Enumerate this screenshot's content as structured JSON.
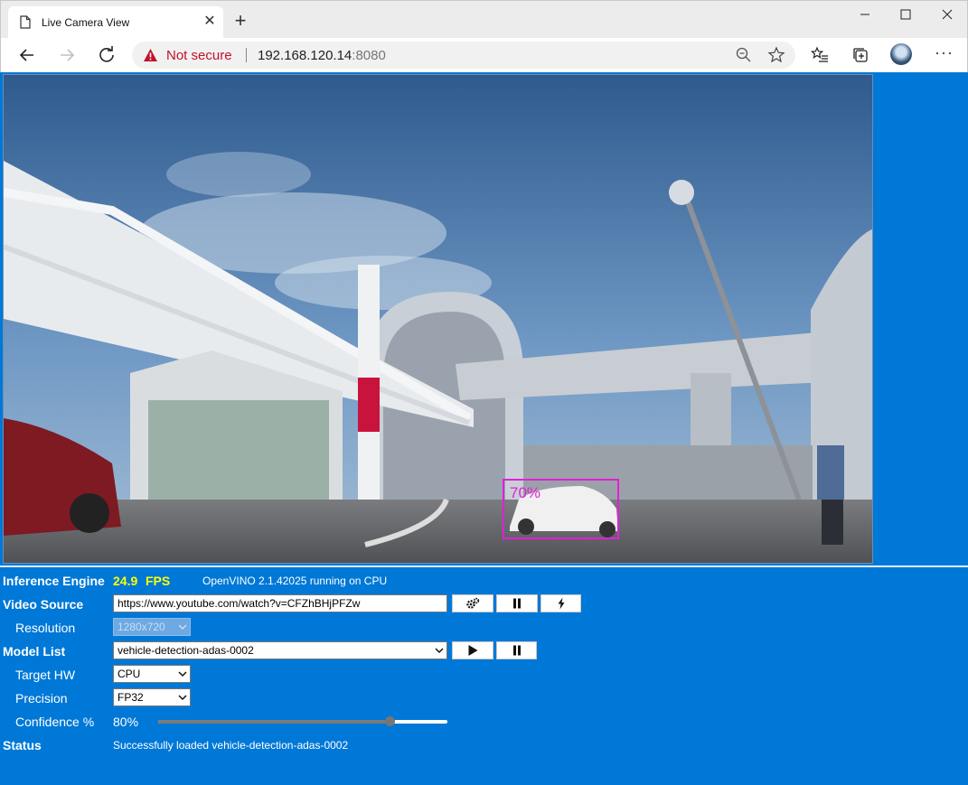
{
  "browser": {
    "tab_title": "Live Camera View",
    "security_label": "Not secure",
    "url_host": "192.168.120.14",
    "url_port": ":8080"
  },
  "detection": {
    "label": "70%",
    "color": "#e020d8"
  },
  "inference": {
    "label": "Inference Engine",
    "fps_value": "24.9",
    "fps_unit": "FPS",
    "engine_info": "OpenVINO 2.1.42025 running on CPU"
  },
  "video_source": {
    "label": "Video Source",
    "url_value": "https://www.youtube.com/watch?v=CFZhBHjPFZw",
    "buttons": [
      "settings-icon",
      "pause-icon",
      "flash-icon"
    ]
  },
  "resolution": {
    "label": "Resolution",
    "selected": "1280x720"
  },
  "model_list": {
    "label": "Model List",
    "selected": "vehicle-detection-adas-0002",
    "buttons": [
      "play-icon",
      "pause-icon"
    ]
  },
  "target_hw": {
    "label": "Target HW",
    "selected": "CPU"
  },
  "precision": {
    "label": "Precision",
    "selected": "FP32"
  },
  "confidence": {
    "label": "Confidence %",
    "value_text": "80%",
    "value": 0.8
  },
  "status": {
    "label": "Status",
    "text": "Successfully loaded vehicle-detection-adas-0002"
  },
  "colors": {
    "page_bg": "#0078d7",
    "fps": "#ffff00",
    "not_secure": "#c4112b"
  }
}
